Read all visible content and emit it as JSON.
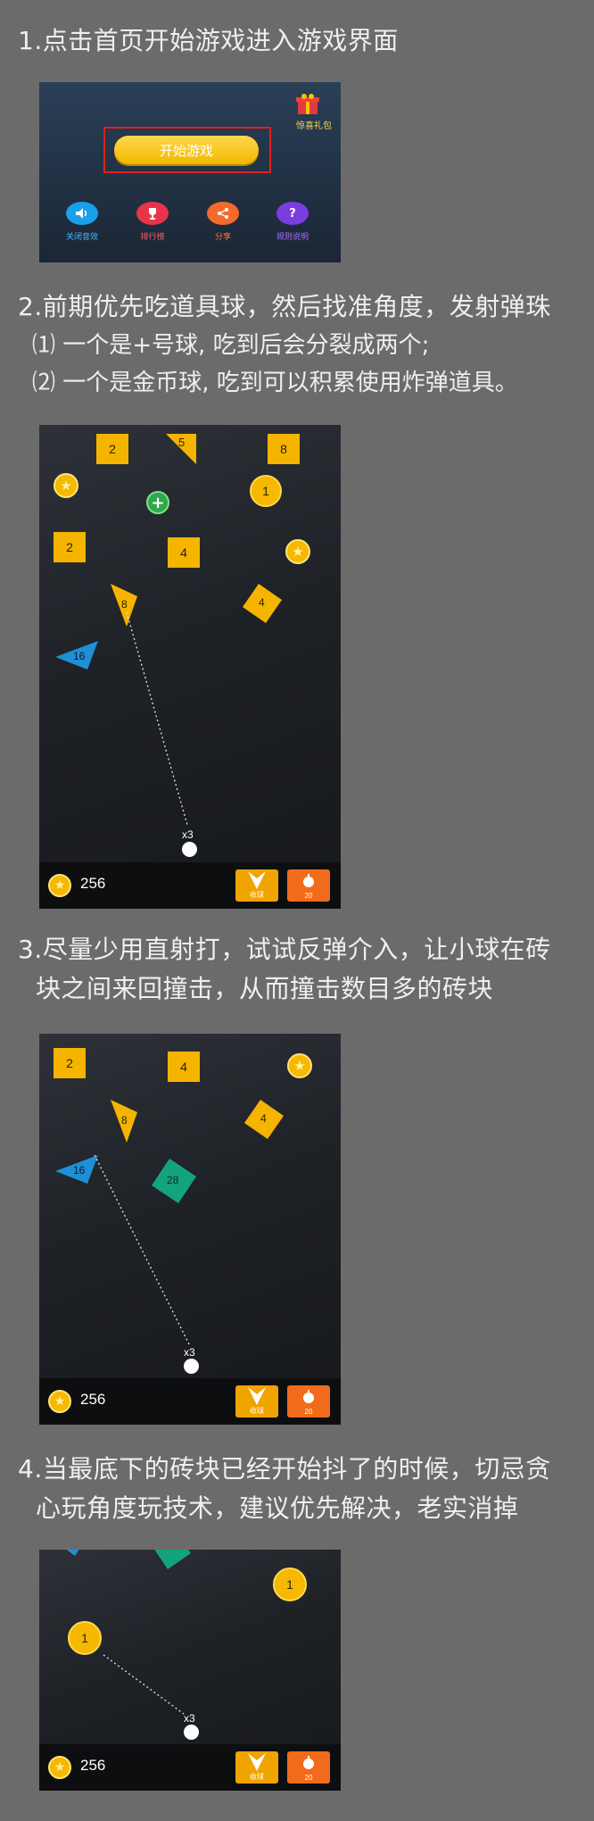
{
  "steps": [
    {
      "title": "1.点击首页开始游戏进入游戏界面"
    },
    {
      "title": "2.前期优先吃道具球，然后找准角度，发射弹珠",
      "notes": [
        "⑴ 一个是+号球, 吃到后会分裂成两个;",
        "⑵ 一个是金币球, 吃到可以积累使用炸弹道具。"
      ]
    },
    {
      "title_lines": [
        "3.尽量少用直射打，试试反弹介入，让小球在砖",
        "块之间来回撞击，从而撞击数目多的砖块"
      ]
    },
    {
      "title_lines": [
        "4.当最底下的砖块已经开始抖了的时候，切忌贪",
        "心玩角度玩技术，建议优先解决，老实消掉"
      ]
    }
  ],
  "home": {
    "start_button": "开始游戏",
    "gift_label": "惊喜礼包",
    "menu": [
      {
        "label": "关闭音效",
        "icon": "speaker-icon",
        "color": "#1aa0e8"
      },
      {
        "label": "排行榜",
        "icon": "trophy-icon",
        "color": "#e8344a"
      },
      {
        "label": "分享",
        "icon": "share-icon",
        "color": "#f26b2a"
      },
      {
        "label": "规则说明",
        "icon": "question-icon",
        "color": "#7a3ee0"
      }
    ],
    "colors": {
      "start_button": "#f6c400",
      "highlight_box": "#e0201e"
    }
  },
  "game": {
    "coins": "256",
    "ball_count": "x3",
    "btn_collect": "收球",
    "btn_bomb_cost": "20",
    "shot2_blocks": [
      "2",
      "5",
      "8",
      "1",
      "2",
      "4",
      "8",
      "4",
      "16"
    ],
    "shot3_blocks": [
      "2",
      "4",
      "8",
      "4",
      "16",
      "28"
    ],
    "shot4_blocks": [
      "1",
      "1"
    ],
    "colors": {
      "brick": "#f5b400",
      "triangle_blue": "#1f8fd6",
      "diamond_green": "#14a37f",
      "plus_ball": "#2ea84a"
    }
  }
}
